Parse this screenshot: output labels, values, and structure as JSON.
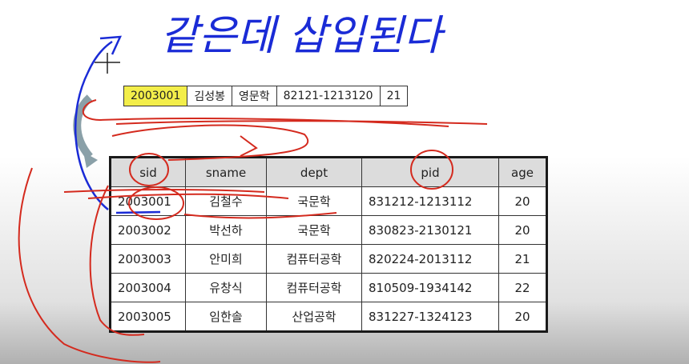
{
  "handwriting": "같은데 삽입된다",
  "new_tuple": {
    "sid": "2003001",
    "sname": "김성봉",
    "dept": "영문학",
    "pid": "82121-1213120",
    "age": "21"
  },
  "table": {
    "headers": [
      "sid",
      "sname",
      "dept",
      "pid",
      "age"
    ],
    "rows": [
      {
        "sid": "2003001",
        "sname": "김철수",
        "dept": "국문학",
        "pid": "831212-1213112",
        "age": "20"
      },
      {
        "sid": "2003002",
        "sname": "박선하",
        "dept": "국문학",
        "pid": "830823-2130121",
        "age": "20"
      },
      {
        "sid": "2003003",
        "sname": "안미희",
        "dept": "컴퓨터공학",
        "pid": "820224-2013112",
        "age": "21"
      },
      {
        "sid": "2003004",
        "sname": "유창식",
        "dept": "컴퓨터공학",
        "pid": "810509-1934142",
        "age": "22"
      },
      {
        "sid": "2003005",
        "sname": "임한솔",
        "dept": "산업공학",
        "pid": "831227-1324123",
        "age": "20"
      }
    ]
  },
  "colors": {
    "annotation_blue": "#1a2bd6",
    "annotation_red": "#d42a1e",
    "highlight_yellow": "#f3ee4a",
    "arrow_gray": "#8aa0a8"
  }
}
